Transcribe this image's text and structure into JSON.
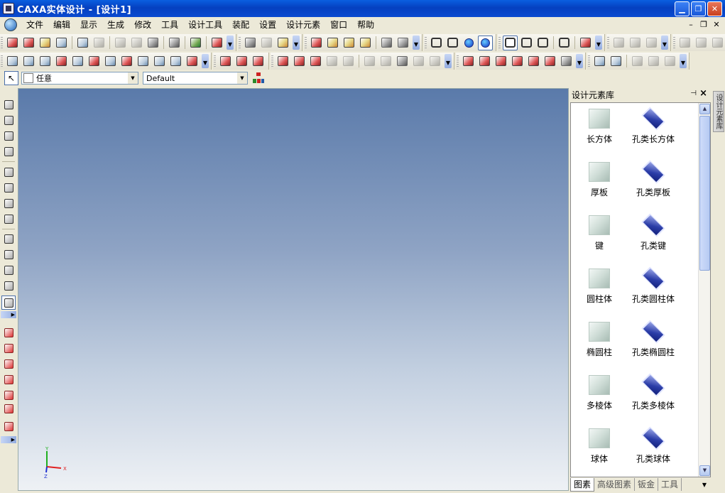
{
  "window": {
    "title": "CAXA实体设计 - [设计1]"
  },
  "window_buttons": {
    "minimize": "▁",
    "restore": "❐",
    "close": "✕"
  },
  "mdi_buttons": {
    "minimize": "–",
    "restore": "❐",
    "close": "✕"
  },
  "menu": [
    "文件",
    "编辑",
    "显示",
    "生成",
    "修改",
    "工具",
    "设计工具",
    "装配",
    "设置",
    "设计元素",
    "窗口",
    "帮助"
  ],
  "selection_bar": {
    "filter_value": "任意",
    "style_value": "Default"
  },
  "panel": {
    "title": "设计元素库",
    "items": [
      {
        "label": "长方体",
        "kind": "solid"
      },
      {
        "label": "孔类长方体",
        "kind": "hole"
      },
      {
        "label": "厚板",
        "kind": "solid"
      },
      {
        "label": "孔类厚板",
        "kind": "hole"
      },
      {
        "label": "键",
        "kind": "solid"
      },
      {
        "label": "孔类键",
        "kind": "hole"
      },
      {
        "label": "圆柱体",
        "kind": "solid"
      },
      {
        "label": "孔类圆柱体",
        "kind": "hole"
      },
      {
        "label": "椭圆柱",
        "kind": "solid"
      },
      {
        "label": "孔类椭圆柱",
        "kind": "hole"
      },
      {
        "label": "多棱体",
        "kind": "solid"
      },
      {
        "label": "孔类多棱体",
        "kind": "hole"
      },
      {
        "label": "球体",
        "kind": "solid"
      },
      {
        "label": "孔类球体",
        "kind": "hole"
      }
    ],
    "tabs": [
      "图素",
      "高级图素",
      "钣金",
      "工具"
    ]
  },
  "side_tab": {
    "label": "设计元素库"
  },
  "axis": {
    "x": "X",
    "y": "Y",
    "z": "Z",
    "x_color": "#e02020",
    "y_color": "#20b020",
    "z_color": "#2030d0"
  },
  "icons": {
    "toolbar_row_1": [
      "new-doc-icon",
      "new-drawing-icon",
      "open-icon",
      "save-icon",
      "undo-icon",
      "redo-icon",
      "copy-icon",
      "paste-icon",
      "print-icon",
      "spell-icon",
      "render-icon",
      "help-icon",
      "move-icon",
      "orbit-icon",
      "part-icon",
      "extrude-icon",
      "revolve-icon",
      "sweep-icon",
      "loft-icon",
      "text-icon",
      "section-icon",
      "box-view-icon",
      "wire-view-icon",
      "sphere-icon",
      "sphere-shaded-icon",
      "iso-view-icon",
      "front-view-icon",
      "cyl-view-icon",
      "screen-icon",
      "book-icon",
      "globe-icon",
      "globe-2-icon",
      "globe-3-icon",
      "frame-icon",
      "frame-2-icon",
      "frame-3-icon"
    ],
    "toolbar_row_2": [
      "edge-icon",
      "fillet-icon",
      "chamfer-icon",
      "shell-icon",
      "draft-icon",
      "curve-icon",
      "split-icon",
      "face-icon",
      "offset-icon",
      "mirror-icon",
      "pattern-icon",
      "cut-icon",
      "surface-icon",
      "surface-2-icon",
      "surface-3-icon",
      "surface-4-icon",
      "surface-5-icon",
      "blend-icon",
      "blend-2-icon",
      "blend-3-icon",
      "blend-4-icon",
      "blend-5-icon",
      "blend-6-icon",
      "trim-icon",
      "measure-icon",
      "arrow-icon",
      "cube-icon",
      "point-icon",
      "line-icon",
      "axis-icon",
      "plane-icon",
      "snap-icon",
      "pen-icon",
      "dropper-icon",
      "light-icon",
      "light-2-icon",
      "light-3-icon"
    ]
  }
}
